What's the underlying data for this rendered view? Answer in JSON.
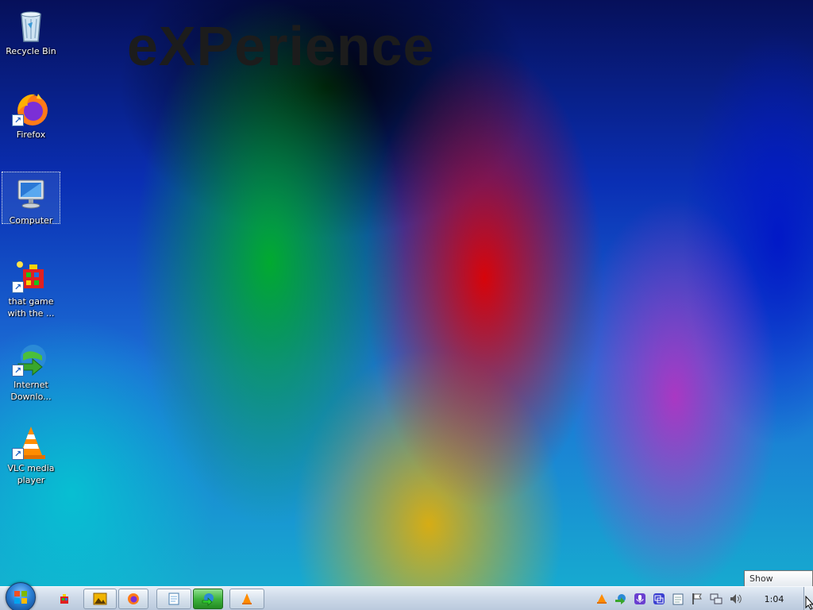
{
  "wallpaper": {
    "brand_text": "eXPerience"
  },
  "desktop_icons": [
    {
      "label": "Recycle Bin",
      "icon": "recycle-bin-icon",
      "shortcut": false
    },
    {
      "label": "Firefox",
      "icon": "firefox-icon",
      "shortcut": true
    },
    {
      "label": "Computer",
      "icon": "computer-icon",
      "shortcut": false,
      "selected": true
    },
    {
      "label": "that game with the ...",
      "icon": "game-icon",
      "shortcut": true
    },
    {
      "label": "Internet Downlo...",
      "icon": "internet-download-manager-icon",
      "shortcut": true
    },
    {
      "label": "VLC media player",
      "icon": "vlc-icon",
      "shortcut": true
    }
  ],
  "taskbar": {
    "start": "start-orb-icon",
    "pinned": [
      {
        "icon": "game-icon"
      },
      {
        "icon": "image-viewer-icon"
      },
      {
        "icon": "firefox-icon"
      },
      {
        "icon": "notepad-icon"
      },
      {
        "icon": "internet-download-manager-icon",
        "active": true
      },
      {
        "icon": "vlc-icon"
      }
    ],
    "tray": [
      "vlc-icon",
      "idm-tray-icon",
      "microphone-icon",
      "display-icon",
      "clipboard-icon",
      "action-center-flag-icon",
      "network-icon",
      "volume-icon"
    ],
    "clock": "1:04",
    "show_desktop_tooltip": "Show desktop"
  },
  "colors": {
    "taskbar": "#cdd9e8",
    "active_button": "#3fb43f",
    "label_text": "#ffffff"
  }
}
